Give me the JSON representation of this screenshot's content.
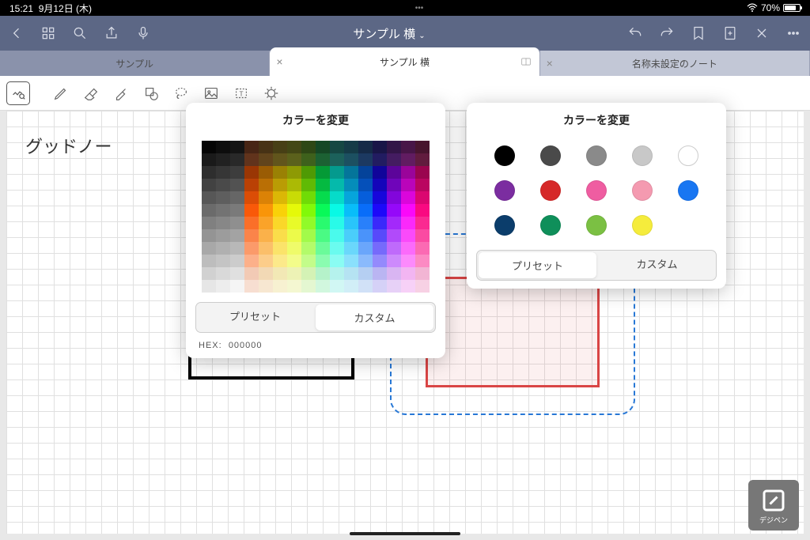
{
  "status": {
    "time": "15:21",
    "date": "9月12日 (木)",
    "battery": "70%",
    "center_dots": "•••"
  },
  "header": {
    "title": "サンプル 横"
  },
  "tabs": [
    {
      "label": "サンプル",
      "active": false
    },
    {
      "label": "サンプル 横",
      "active": true
    },
    {
      "label": "名称未設定のノート",
      "active": false
    }
  ],
  "canvas": {
    "text_partial": "グッドノー"
  },
  "popover1": {
    "title": "カラーを変更",
    "seg_preset": "プリセット",
    "seg_custom": "カスタム",
    "hex_label": "HEX:",
    "hex_value": "000000"
  },
  "popover2": {
    "title": "カラーを変更",
    "seg_preset": "プリセット",
    "seg_custom": "カスタム",
    "swatches": [
      "#000000",
      "#4a4a4a",
      "#8a8a8a",
      "#c8c8c8",
      "#ffffff",
      "#7b2da0",
      "#d62828",
      "#ef5da1",
      "#f49ab0",
      "#1876f2",
      "#0b3d6b",
      "#0f8f5a",
      "#7bc043",
      "#f5ec3c"
    ]
  },
  "logo": {
    "text": "デジペン"
  }
}
